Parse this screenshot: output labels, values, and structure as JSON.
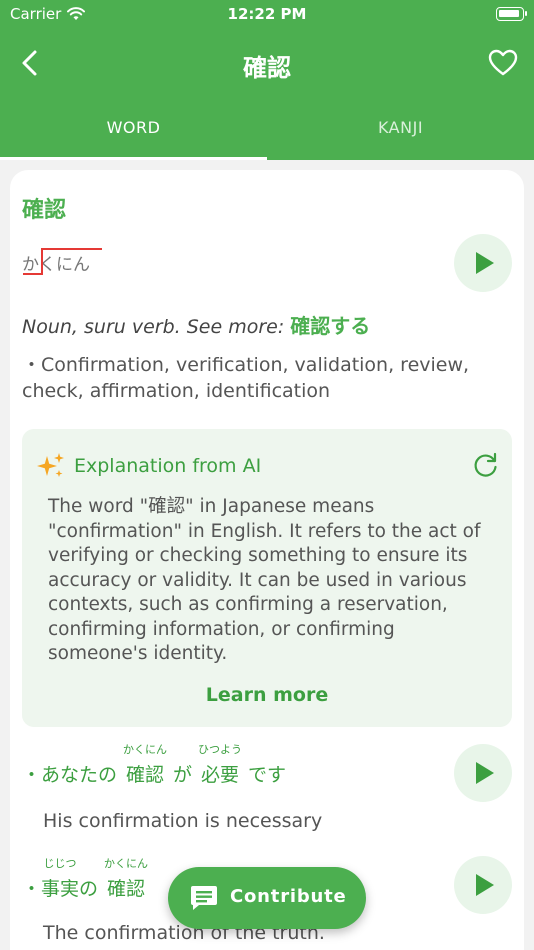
{
  "status": {
    "carrier": "Carrier",
    "time": "12:22 PM"
  },
  "nav": {
    "title": "確認"
  },
  "tabs": [
    {
      "label": "WORD"
    },
    {
      "label": "KANJI"
    }
  ],
  "word": {
    "title": "確認",
    "reading": "かくにん",
    "part_of_speech": "Noun, suru verb. See more: ",
    "see_more_link": "確認する",
    "meanings": "・Confirmation, verification, validation, review, check, affirmation, identification"
  },
  "ai": {
    "title": "Explanation from AI",
    "text": "The word \"確認\" in Japanese means \"confirmation\" in English. It refers to the act of verifying or checking something to ensure its accuracy or validity. It can be used in various contexts, such as confirming a reservation, confirming information, or confirming someone's identity.",
    "learn_more": "Learn more"
  },
  "examples": [
    {
      "segments": [
        {
          "base": "・あなたの",
          "furi": ""
        },
        {
          "base": "確認",
          "furi": "かくにん"
        },
        {
          "base": "が",
          "furi": ""
        },
        {
          "base": "必要",
          "furi": "ひつよう"
        },
        {
          "base": "です",
          "furi": ""
        }
      ],
      "translation": "His confirmation is necessary"
    },
    {
      "segments": [
        {
          "base": "・事実の",
          "furi": "じじつ"
        },
        {
          "base": "確認",
          "furi": "かくにん"
        }
      ],
      "translation": "The confirmation of the truth."
    }
  ],
  "contribute": {
    "label": "Contribute"
  },
  "colors": {
    "primary": "#4caf50",
    "accent": "#3c9f40",
    "pitch": "#e53935",
    "ai_bg": "#eef6ee"
  },
  "icons": {
    "back": "chevron-left-icon",
    "favorite": "heart-icon",
    "sparkle": "sparkles-icon",
    "refresh": "refresh-icon",
    "play": "play-icon",
    "comment": "comment-icon"
  }
}
